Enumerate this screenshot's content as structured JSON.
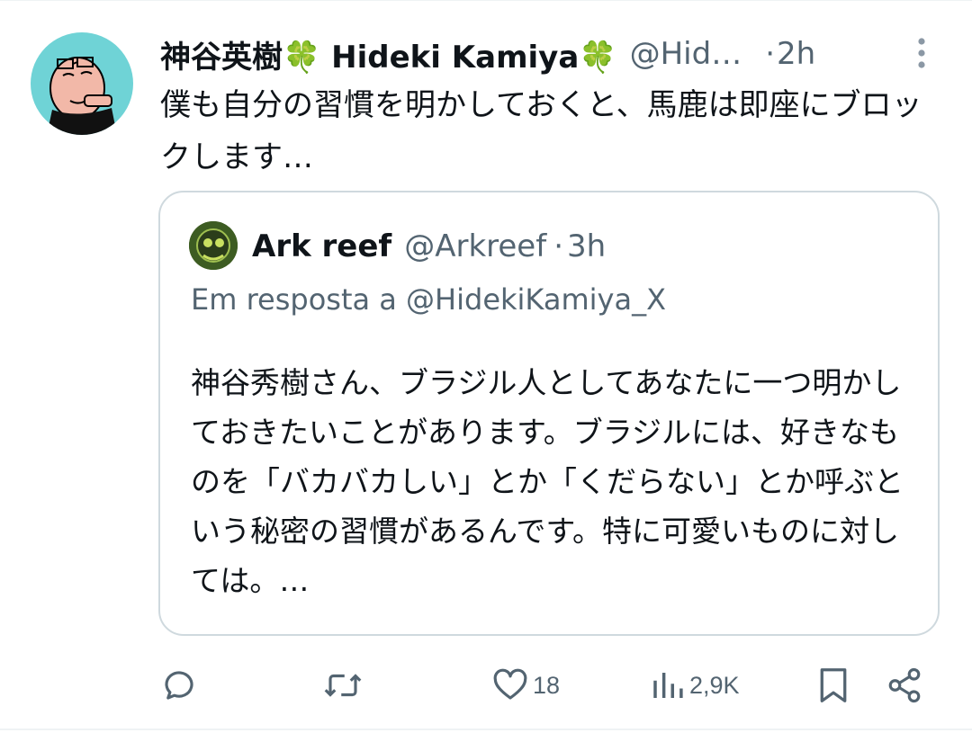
{
  "tweet": {
    "display_name": "神谷英樹🍀 Hideki Kamiya🍀",
    "handle": "@Hid…",
    "separator": "·",
    "time": "2h",
    "text": "僕も自分の習慣を明かしておくと、馬鹿は即座にブロックします…"
  },
  "quote": {
    "display_name": "Ark reef",
    "handle": "@Arkreef",
    "separator": "·",
    "time": "3h",
    "reply_to": "Em resposta a @HidekiKamiya_X",
    "text": "神谷秀樹さん、ブラジル人としてあなたに一つ明かしておきたいことがあります。ブラジルには、好きなものを「バカバカしい」とか「くだらない」とか呼ぶという秘密の習慣があるんです。特に可愛いものに対しては。…"
  },
  "actions": {
    "likes": "18",
    "views": "2,9K"
  },
  "colors": {
    "text": "#0f1419",
    "secondary": "#536471",
    "border": "#cfd9de",
    "avatar_bg": "#6fd3d6"
  },
  "icons": [
    "more-icon",
    "reply-icon",
    "repost-icon",
    "like-icon",
    "views-icon",
    "bookmark-icon",
    "share-icon"
  ]
}
